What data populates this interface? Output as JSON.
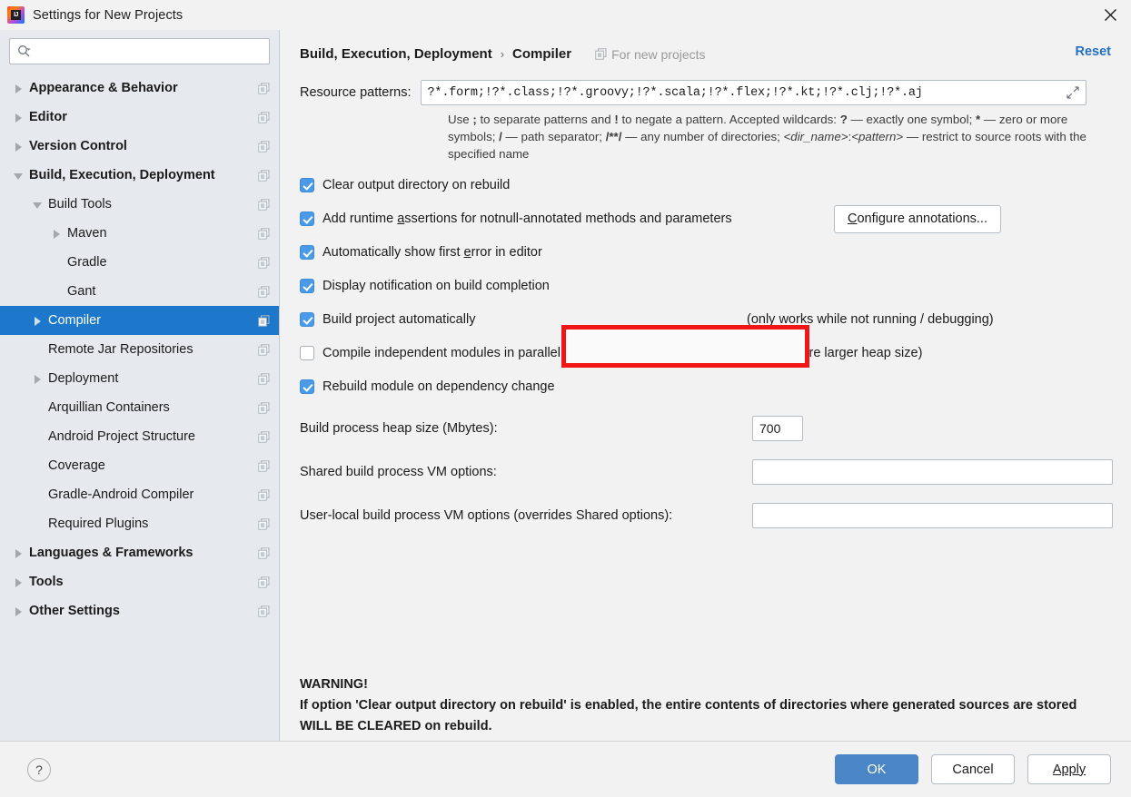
{
  "window": {
    "title": "Settings for New Projects",
    "logo_text": "IJ",
    "close_label": "✕"
  },
  "sidebar": {
    "search": {
      "value": "",
      "placeholder": ""
    },
    "items": [
      {
        "label": "Appearance & Behavior",
        "indent": 0,
        "arrow": "right",
        "bold": true,
        "selected": false,
        "copy": true
      },
      {
        "label": "Editor",
        "indent": 0,
        "arrow": "right",
        "bold": true,
        "selected": false,
        "copy": true
      },
      {
        "label": "Version Control",
        "indent": 0,
        "arrow": "right",
        "bold": true,
        "selected": false,
        "copy": true
      },
      {
        "label": "Build, Execution, Deployment",
        "indent": 0,
        "arrow": "down",
        "bold": true,
        "selected": false,
        "copy": true
      },
      {
        "label": "Build Tools",
        "indent": 1,
        "arrow": "down",
        "bold": false,
        "selected": false,
        "copy": true
      },
      {
        "label": "Maven",
        "indent": 2,
        "arrow": "right",
        "bold": false,
        "selected": false,
        "copy": true
      },
      {
        "label": "Gradle",
        "indent": 2,
        "arrow": "none",
        "bold": false,
        "selected": false,
        "copy": true
      },
      {
        "label": "Gant",
        "indent": 2,
        "arrow": "none",
        "bold": false,
        "selected": false,
        "copy": true
      },
      {
        "label": "Compiler",
        "indent": 1,
        "arrow": "right",
        "bold": false,
        "selected": true,
        "copy": true
      },
      {
        "label": "Remote Jar Repositories",
        "indent": 1,
        "arrow": "none",
        "bold": false,
        "selected": false,
        "copy": true
      },
      {
        "label": "Deployment",
        "indent": 1,
        "arrow": "right",
        "bold": false,
        "selected": false,
        "copy": true
      },
      {
        "label": "Arquillian Containers",
        "indent": 1,
        "arrow": "none",
        "bold": false,
        "selected": false,
        "copy": true
      },
      {
        "label": "Android Project Structure",
        "indent": 1,
        "arrow": "none",
        "bold": false,
        "selected": false,
        "copy": true
      },
      {
        "label": "Coverage",
        "indent": 1,
        "arrow": "none",
        "bold": false,
        "selected": false,
        "copy": true
      },
      {
        "label": "Gradle-Android Compiler",
        "indent": 1,
        "arrow": "none",
        "bold": false,
        "selected": false,
        "copy": true
      },
      {
        "label": "Required Plugins",
        "indent": 1,
        "arrow": "none",
        "bold": false,
        "selected": false,
        "copy": true
      },
      {
        "label": "Languages & Frameworks",
        "indent": 0,
        "arrow": "right",
        "bold": true,
        "selected": false,
        "copy": true
      },
      {
        "label": "Tools",
        "indent": 0,
        "arrow": "right",
        "bold": true,
        "selected": false,
        "copy": true
      },
      {
        "label": "Other Settings",
        "indent": 0,
        "arrow": "right",
        "bold": true,
        "selected": false,
        "copy": true
      }
    ]
  },
  "header": {
    "crumb1": "Build, Execution, Deployment",
    "separator": "›",
    "crumb2": "Compiler",
    "for_new_projects": "For new projects",
    "reset": "Reset"
  },
  "main": {
    "resource_patterns_label": "Resource patterns:",
    "resource_patterns_value": "?*.form;!?*.class;!?*.groovy;!?*.scala;!?*.flex;!?*.kt;!?*.clj;!?*.aj",
    "hint_line1_a": "Use ",
    "hint_semicolon": ";",
    "hint_line1_b": " to separate patterns and ",
    "hint_bang": "!",
    "hint_line1_c": " to negate a pattern. Accepted wildcards: ",
    "hint_q": "?",
    "hint_line1_d": " — exactly one symbol; ",
    "hint_star": "*",
    "hint_line1_e": " — zero or more symbols; ",
    "hint_slash": "/",
    "hint_line2_a": " — path separator; ",
    "hint_dblstar": "/**/",
    "hint_line2_b": " — any number of directories; ",
    "hint_dirname": "<dir_name>",
    "hint_colon": ":",
    "hint_pattern": "<pattern>",
    "hint_line2_c": " — restrict to source roots with the specified name",
    "checkboxes": [
      {
        "label": "Clear output directory on rebuild",
        "checked": true,
        "mnemonic": "C",
        "note": ""
      },
      {
        "label": "Add runtime assertions for notnull-annotated methods and parameters",
        "checked": true,
        "mnemonic": "a",
        "note": ""
      },
      {
        "label": "Automatically show first error in editor",
        "checked": true,
        "mnemonic": "e",
        "note": ""
      },
      {
        "label": "Display notification on build completion",
        "checked": true,
        "mnemonic": "",
        "note": ""
      },
      {
        "label": "Build project automatically",
        "checked": true,
        "mnemonic": "",
        "note": "(only works while not running / debugging)"
      },
      {
        "label": "Compile independent modules in parallel",
        "checked": false,
        "mnemonic": "",
        "note": "(may require larger heap size)"
      },
      {
        "label": "Rebuild module on dependency change",
        "checked": true,
        "mnemonic": "",
        "note": ""
      }
    ],
    "configure_annotations_button": "Configure annotations...",
    "configure_annotations_mnemonic": "C",
    "heap_label": "Build process heap size (Mbytes):",
    "heap_value": "700",
    "shared_vm_label": "Shared build process VM options:",
    "shared_vm_value": "",
    "user_vm_label": "User-local build process VM options (overrides Shared options):",
    "user_vm_value": "",
    "warning_title": "WARNING!",
    "warning_body": "If option 'Clear output directory on rebuild' is enabled, the entire contents of directories where generated sources are stored WILL BE CLEARED on rebuild."
  },
  "footer": {
    "help": "?",
    "ok": "OK",
    "cancel": "Cancel",
    "apply": "Apply",
    "apply_mnemonic": "A"
  },
  "annotation": {
    "highlight_color": "#f01616",
    "target": "Build project automatically"
  },
  "colors": {
    "selection_blue": "#1d78cb",
    "primary_button": "#4a86c5",
    "link_blue": "#2470c4",
    "checkbox_blue": "#4a9ae8",
    "sidebar_bg": "#e6eaee",
    "panel_bg": "#f2f2f2"
  }
}
